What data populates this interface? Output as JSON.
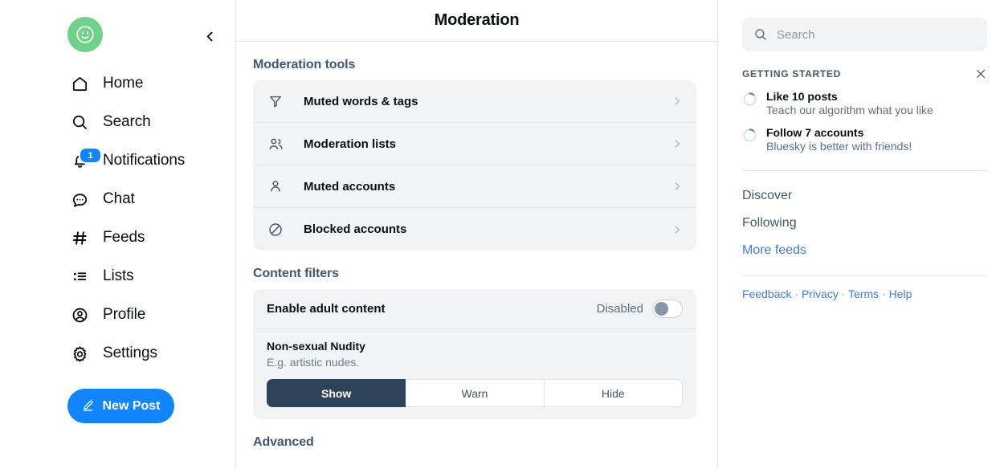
{
  "left_nav": {
    "avatar_icon": "smiley-avatar",
    "collapse_icon": "chevron-left-icon",
    "items": [
      {
        "label": "Home",
        "icon": "home-icon",
        "badge": null
      },
      {
        "label": "Search",
        "icon": "search-icon",
        "badge": null
      },
      {
        "label": "Notifications",
        "icon": "bell-icon",
        "badge": "1"
      },
      {
        "label": "Chat",
        "icon": "chat-bubble-icon",
        "badge": null
      },
      {
        "label": "Feeds",
        "icon": "hashtag-icon",
        "badge": null
      },
      {
        "label": "Lists",
        "icon": "list-icon",
        "badge": null
      },
      {
        "label": "Profile",
        "icon": "user-circle-icon",
        "badge": null
      },
      {
        "label": "Settings",
        "icon": "gear-icon",
        "badge": null
      }
    ],
    "new_post": {
      "label": "New Post",
      "icon": "compose-icon"
    }
  },
  "main": {
    "header_title": "Moderation",
    "moderation_tools": {
      "section_label": "Moderation tools",
      "items": [
        {
          "label": "Muted words & tags",
          "icon": "funnel-icon"
        },
        {
          "label": "Moderation lists",
          "icon": "people-icon"
        },
        {
          "label": "Muted accounts",
          "icon": "person-icon"
        },
        {
          "label": "Blocked accounts",
          "icon": "block-circle-icon"
        }
      ]
    },
    "content_filters": {
      "section_label": "Content filters",
      "adult_content": {
        "label": "Enable adult content",
        "state": "Disabled",
        "enabled": false
      },
      "filters": [
        {
          "name": "Non-sexual Nudity",
          "description": "E.g. artistic nudes.",
          "options": [
            "Show",
            "Warn",
            "Hide"
          ],
          "selected": "Show"
        }
      ]
    },
    "advanced": {
      "section_label": "Advanced"
    }
  },
  "right": {
    "search": {
      "placeholder": "Search",
      "value": "",
      "icon": "search-icon"
    },
    "getting_started": {
      "title": "GETTING STARTED",
      "close_icon": "close-icon",
      "items": [
        {
          "title": "Like 10 posts",
          "subtitle": "Teach our algorithm what you like",
          "icon": "progress-ring-icon"
        },
        {
          "title": "Follow 7 accounts",
          "subtitle": "Bluesky is better with friends!",
          "icon": "progress-ring-icon"
        }
      ]
    },
    "feeds": [
      {
        "label": "Discover",
        "style": "plain"
      },
      {
        "label": "Following",
        "style": "plain"
      },
      {
        "label": "More feeds",
        "style": "link"
      }
    ],
    "footer": {
      "links": [
        "Feedback",
        "Privacy",
        "Terms",
        "Help"
      ],
      "separator": "·"
    }
  },
  "colors": {
    "brand_blue": "#1185fe",
    "link_blue": "#3f7ed4",
    "card_gray": "#f1f3f5",
    "active_segment": "#2e4358",
    "avatar_green": "#6fd18a"
  }
}
